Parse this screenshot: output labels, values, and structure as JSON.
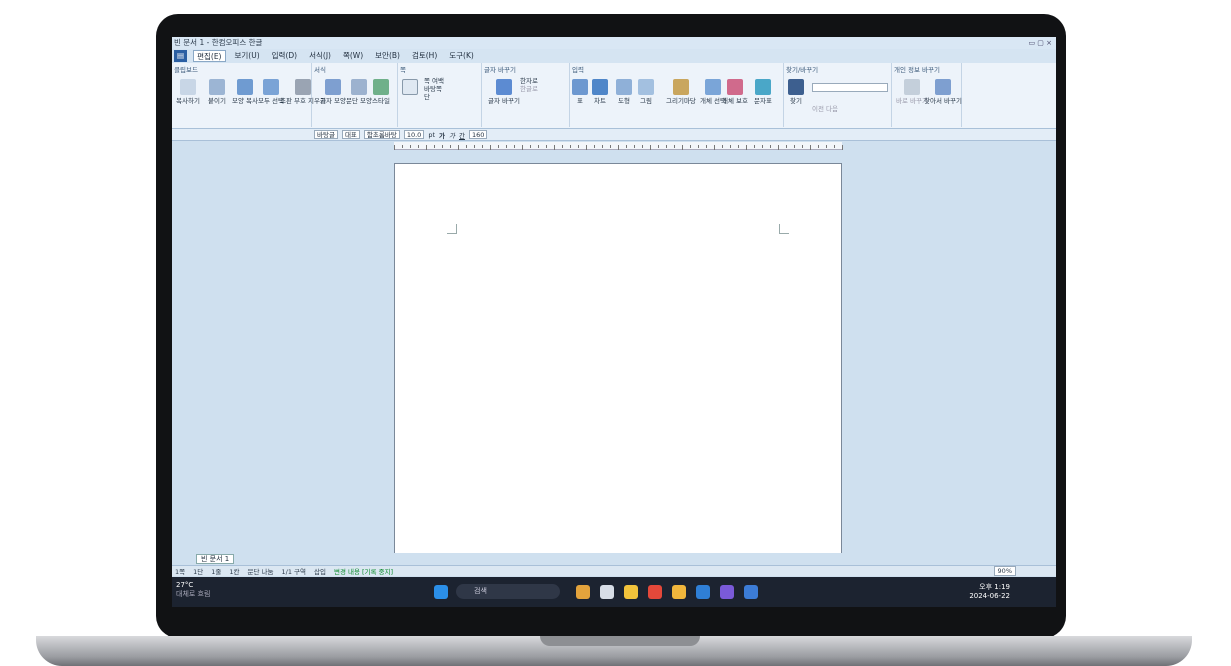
{
  "window": {
    "title": "빈 문서 1 - 한컴오피스 한글"
  },
  "menu": {
    "items": [
      "편집(E)",
      "보기(U)",
      "입력(D)",
      "서식(J)",
      "쪽(W)",
      "보안(B)",
      "검토(H)",
      "도구(K)"
    ]
  },
  "ribbon": {
    "groups": [
      {
        "title": "클립보드",
        "tools": [
          "복사하기",
          "붙이기",
          "모양 복사",
          "모두 선택",
          "조판 부호 지우기"
        ]
      },
      {
        "title": "서식",
        "tools": [
          "글자 모양",
          "문단 모양",
          "스타일"
        ]
      },
      {
        "title": "쪽",
        "tools": [
          "쪽 여백",
          "바탕쪽",
          "단"
        ]
      },
      {
        "title": "글자 바꾸기",
        "tools": [
          "글자 바꾸기",
          "한자로",
          "한글로"
        ]
      },
      {
        "title": "입력",
        "tools": [
          "표",
          "차트",
          "도형",
          "그림",
          "그리기마당",
          "개체 선택",
          "개체 보호",
          "문자표"
        ]
      },
      {
        "title": "찾기/바꾸기",
        "tools": [
          "찾기",
          "이전",
          "다음"
        ]
      },
      {
        "title": "개인 정보 바꾸기",
        "tools": [
          "바로 바꾸기",
          "찾아서 바꾸기"
        ]
      }
    ]
  },
  "formatbar": {
    "style": "바탕글",
    "lang": "대표",
    "font": "함초롬바탕",
    "size": "10.0",
    "unit": "pt",
    "zoom": "160"
  },
  "doc_tab": {
    "label": "빈 문서 1"
  },
  "status": {
    "page": "1쪽",
    "section": "1단",
    "line": "1줄",
    "column": "1칸",
    "break": "문단 나눔",
    "pages": "1/1 구역",
    "mode": "삽입",
    "track": "변경 내용 [기록 중지]",
    "zoom": "90%"
  },
  "taskbar": {
    "weather_temp": "27°C",
    "weather_desc": "대체로 흐림",
    "search_placeholder": "검색",
    "time": "오후 1:19",
    "date": "2024-06-22"
  }
}
